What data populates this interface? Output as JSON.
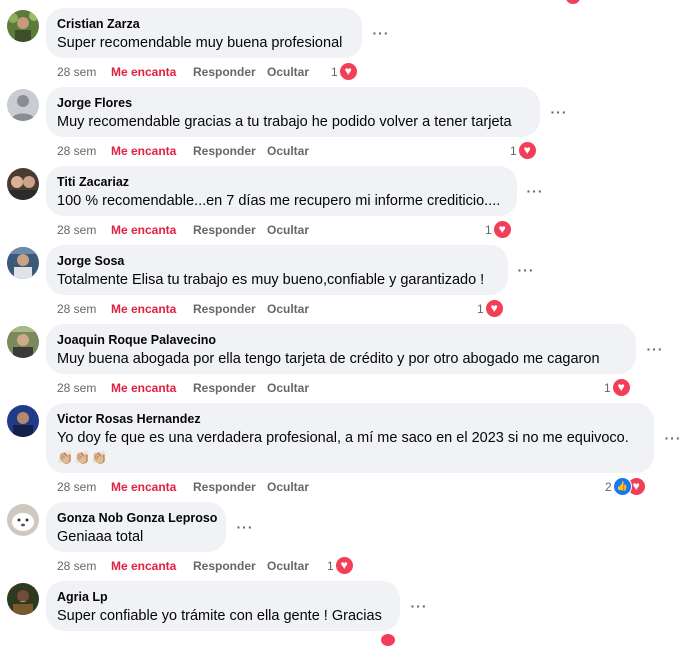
{
  "actions": {
    "like": "Me encanta",
    "reply": "Responder",
    "hide": "Ocultar",
    "more": "···"
  },
  "colors": {
    "accent_red": "#e41e3f",
    "bubble": "#f0f2f5",
    "like_blue": "#1877f2",
    "heart": "#f33e58"
  },
  "comments": [
    {
      "name": "Cristian Zarza",
      "text": "Super recomendable muy buena profesional",
      "time": "28 sem",
      "reaction_count": "1",
      "reactions": [
        "love"
      ]
    },
    {
      "name": "Jorge Flores",
      "text": "Muy recomendable gracias a tu trabajo he podido volver a tener tarjeta",
      "time": "28 sem",
      "reaction_count": "1",
      "reactions": [
        "love"
      ]
    },
    {
      "name": "Titi Zacariaz",
      "text": "100 % recomendable...en 7 días me recupero mi informe crediticio....",
      "time": "28 sem",
      "reaction_count": "1",
      "reactions": [
        "love"
      ]
    },
    {
      "name": "Jorge Sosa",
      "text": "Totalmente Elisa tu trabajo es muy bueno,confiable y garantizado !",
      "time": "28 sem",
      "reaction_count": "1",
      "reactions": [
        "love"
      ]
    },
    {
      "name": "Joaquin Roque Palavecino",
      "text": "Muy buena abogada por ella tengo tarjeta de crédito y por otro abogado me cagaron",
      "time": "28 sem",
      "reaction_count": "1",
      "reactions": [
        "love"
      ]
    },
    {
      "name": "Victor Rosas Hernandez",
      "text": "Yo doy fe que es una verdadera profesional, a mí me saco en el 2023 si no me equivoco.",
      "text2": "👏🏼👏🏼👏🏼",
      "time": "28 sem",
      "reaction_count": "2",
      "reactions": [
        "like",
        "love"
      ]
    },
    {
      "name": "Gonza Nob Gonza Leproso",
      "text": "Geniaaa total",
      "time": "28 sem",
      "reaction_count": "1",
      "reactions": [
        "love"
      ]
    },
    {
      "name": "Agria Lp",
      "text": "Super confiable yo trámite con ella gente ! Gracias",
      "time": "",
      "reaction_count": "",
      "reactions": []
    }
  ]
}
